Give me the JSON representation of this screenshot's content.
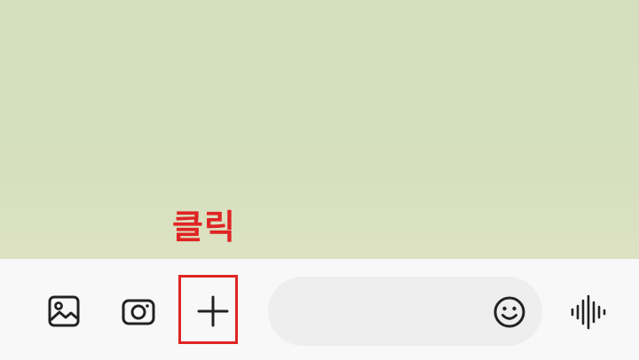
{
  "annotation": {
    "label": "클릭",
    "color": "#e02424"
  },
  "input_bar": {
    "message_placeholder": "",
    "message_value": ""
  },
  "icons": {
    "gallery": "image-icon",
    "camera": "camera-icon",
    "attach": "plus-icon",
    "emoji": "smiley-icon",
    "voice": "voice-wave-icon"
  },
  "colors": {
    "chat_background": "#d5e0bf",
    "input_bar_background": "#f8f8f9",
    "highlight": "#e02424"
  }
}
